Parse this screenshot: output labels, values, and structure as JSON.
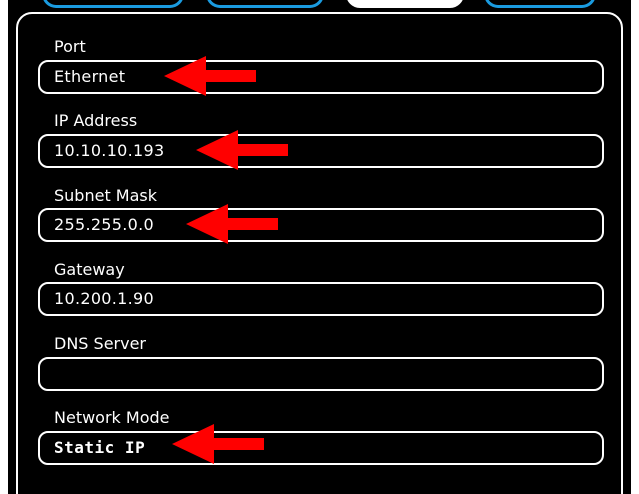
{
  "fields": [
    {
      "label": "Port",
      "value": "Ethernet"
    },
    {
      "label": "IP Address",
      "value": "10.10.10.193"
    },
    {
      "label": "Subnet Mask",
      "value": "255.255.0.0"
    },
    {
      "label": "Gateway",
      "value": "10.200.1.90"
    },
    {
      "label": "DNS Server",
      "value": ""
    },
    {
      "label": "Network Mode",
      "value": "Static IP"
    }
  ],
  "colors": {
    "background": "#000000",
    "text": "#ffffff",
    "tab_accent": "#1a9be0",
    "arrow": "#ff0000"
  },
  "icons": {
    "arrow": "red-left-arrow-icon"
  }
}
